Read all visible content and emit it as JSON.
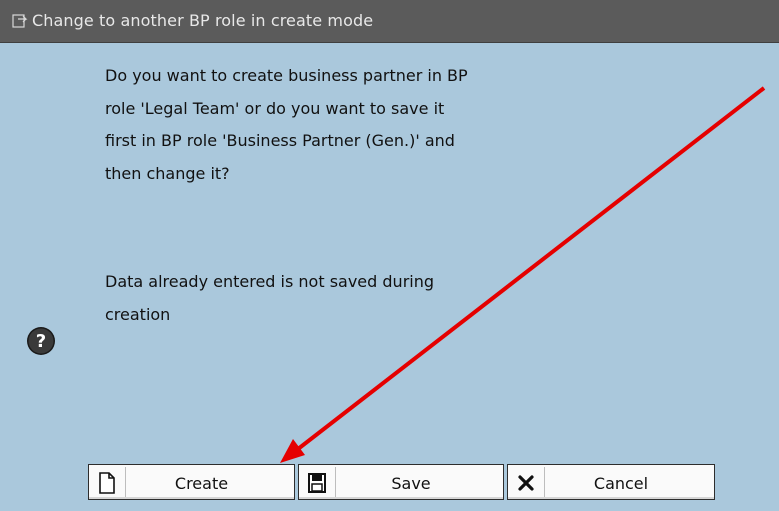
{
  "window": {
    "title": "Change to another BP role in create mode",
    "icon": "dialog-icon"
  },
  "message": {
    "paragraph_1": [
      "Do you want to create business partner in BP",
      "role 'Legal Team' or do you want to save it",
      "first in BP role 'Business Partner (Gen.)' and",
      "then change it?"
    ],
    "paragraph_2": [
      "Data already entered is not saved during",
      "creation"
    ],
    "icon": "question-icon"
  },
  "buttons": {
    "create_label": "Create",
    "save_label": "Save",
    "cancel_label": "Cancel",
    "create_icon": "document-icon",
    "save_icon": "floppy-disk-icon",
    "cancel_icon": "cancel-x-icon"
  },
  "annotation": {
    "arrow_color": "#e50000"
  },
  "colors": {
    "background": "#aac8dc",
    "titlebar": "#5b5b5b"
  }
}
